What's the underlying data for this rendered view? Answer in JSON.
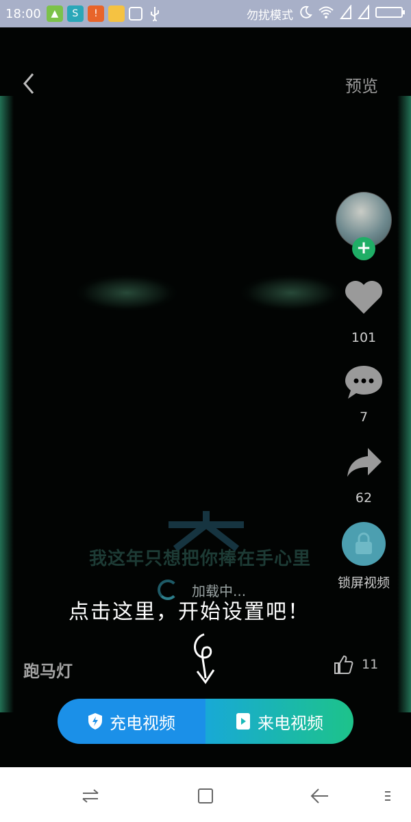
{
  "status_bar": {
    "time": "18:00",
    "dnd_label": "勿扰模式",
    "icons": [
      "android-icon",
      "sync-icon",
      "warning-icon",
      "folder-icon",
      "cleaner-icon",
      "usb-icon",
      "moon-icon",
      "wifi-icon",
      "signal-icon",
      "signal-icon",
      "battery-icon"
    ]
  },
  "header": {
    "preview_label": "预览"
  },
  "video": {
    "watermark_text": "我这年只想把你捧在手心里",
    "loading_text": "加载中..."
  },
  "side_actions": {
    "like_count": "101",
    "comment_count": "7",
    "share_count": "62",
    "lock_label": "锁屏视频"
  },
  "hint": {
    "text": "点击这里，开始设置吧！"
  },
  "bottom_info": {
    "marquee_label": "跑马灯",
    "like_count": "11"
  },
  "cta": {
    "left_label": "充电视频",
    "right_label": "来电视频"
  },
  "colors": {
    "status_bar_bg": "#a8b0c8",
    "cta_left": "#1b90e8",
    "cta_right_start": "#18a9d6",
    "cta_right_end": "#1dc38a",
    "follow_plus": "#1fae66",
    "lock_circle": "#4c9fb0"
  }
}
